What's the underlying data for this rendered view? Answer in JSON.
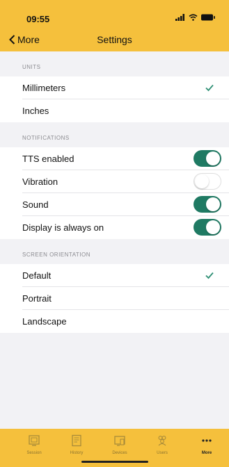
{
  "status": {
    "time": "09:55"
  },
  "nav": {
    "back_label": "More",
    "title": "Settings"
  },
  "sections": {
    "units": {
      "header": "UNITS",
      "items": [
        {
          "label": "Millimeters",
          "selected": true
        },
        {
          "label": "Inches",
          "selected": false
        }
      ]
    },
    "notifications": {
      "header": "NOTIFICATIONS",
      "items": [
        {
          "label": "TTS enabled",
          "on": true
        },
        {
          "label": "Vibration",
          "on": false
        },
        {
          "label": "Sound",
          "on": true
        },
        {
          "label": "Display is always on",
          "on": true
        }
      ]
    },
    "orientation": {
      "header": "SCREEN ORIENTATION",
      "items": [
        {
          "label": "Default",
          "selected": true
        },
        {
          "label": "Portrait",
          "selected": false
        },
        {
          "label": "Landscape",
          "selected": false
        }
      ]
    }
  },
  "tabbar": {
    "items": [
      {
        "label": "Session",
        "icon": "session-icon"
      },
      {
        "label": "History",
        "icon": "history-icon"
      },
      {
        "label": "Devices",
        "icon": "devices-icon"
      },
      {
        "label": "Users",
        "icon": "users-icon"
      },
      {
        "label": "More",
        "icon": "more-icon",
        "active": true
      }
    ]
  },
  "colors": {
    "accent": "#f5c03c",
    "toggle_on": "#1f7a63",
    "check": "#2e8f74",
    "background": "#f2f2f5"
  }
}
